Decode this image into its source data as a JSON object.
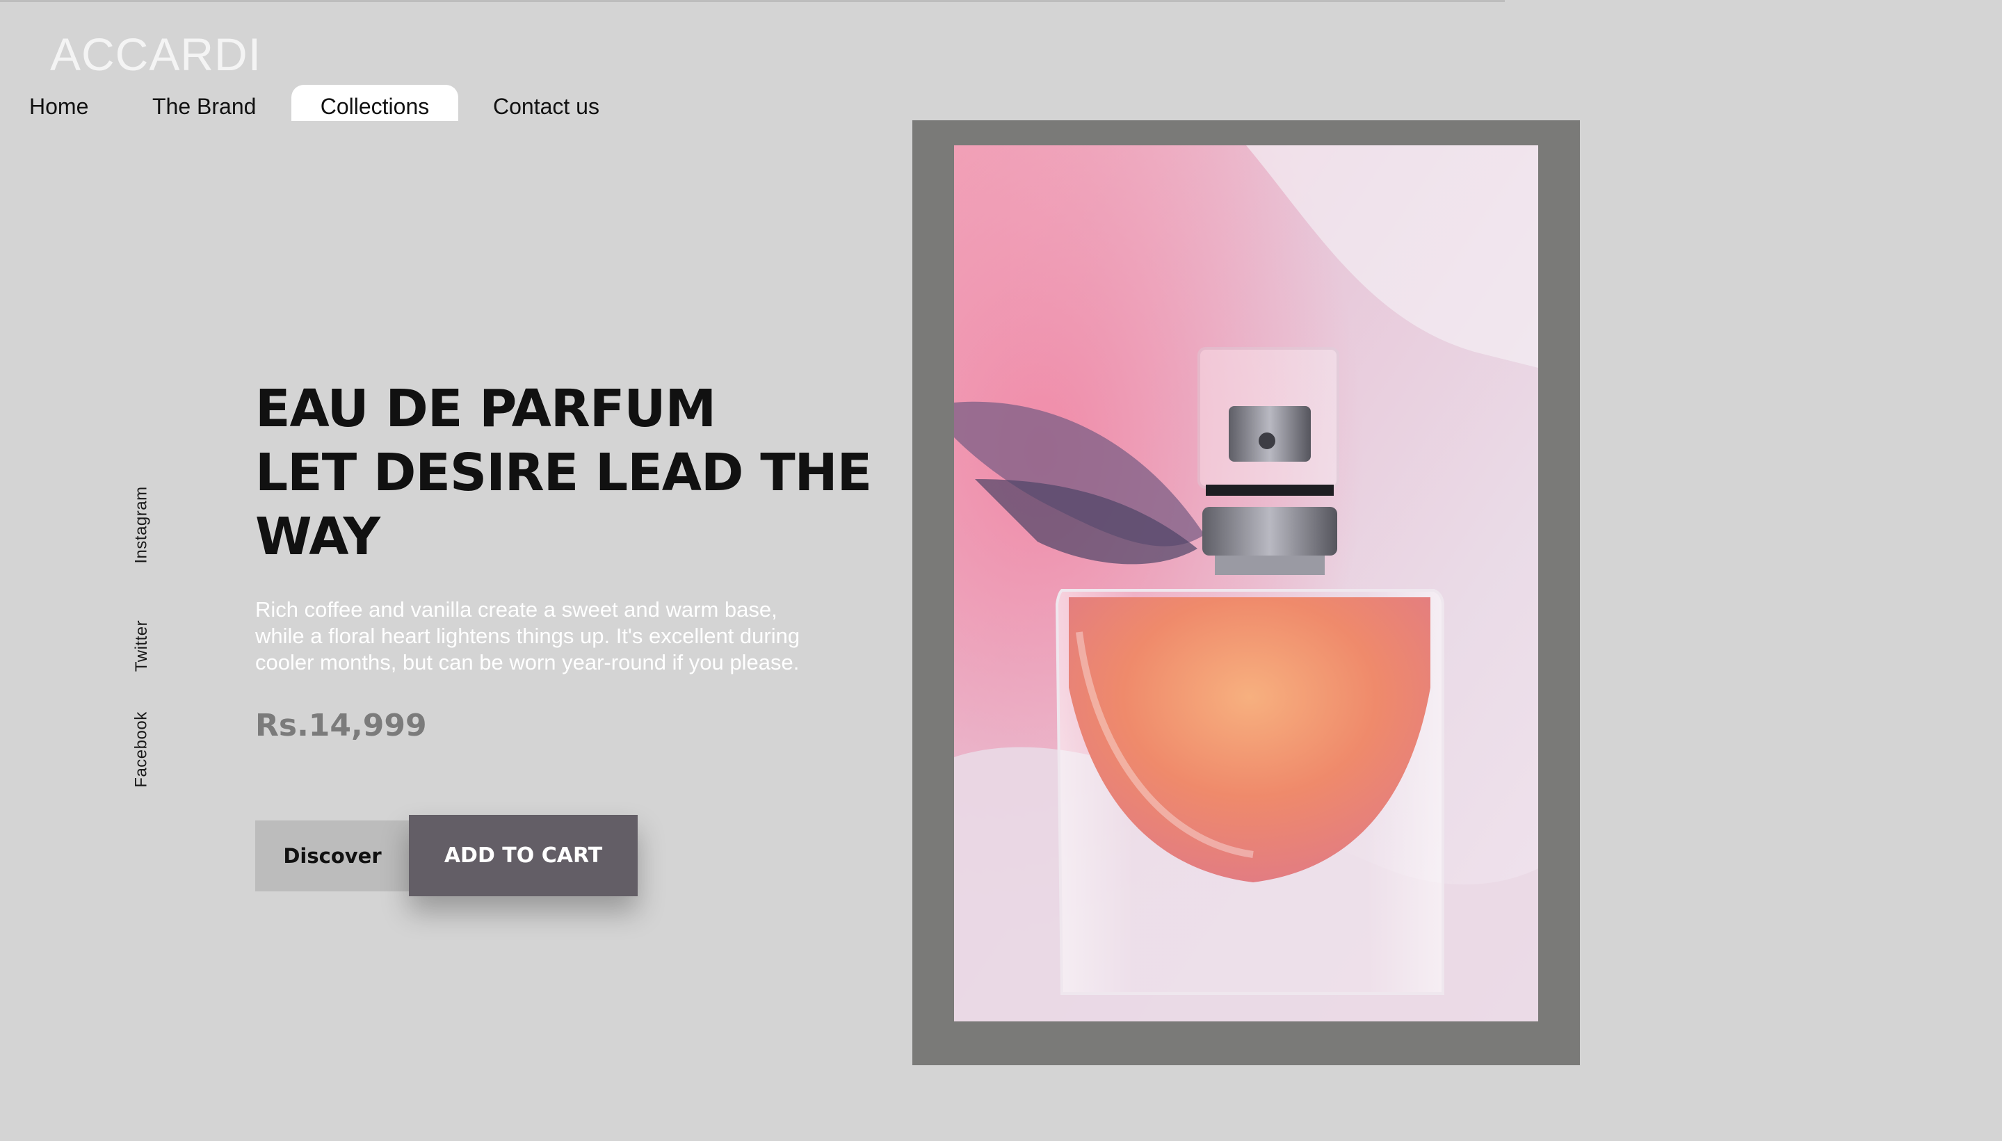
{
  "brand": {
    "logo_text": "ACCARDI"
  },
  "nav": {
    "items": [
      {
        "label": "Home"
      },
      {
        "label": "The Brand"
      },
      {
        "label": "Collections",
        "active": true
      },
      {
        "label": "Contact us"
      }
    ]
  },
  "social": {
    "instagram": "Instagram",
    "twitter": "Twitter",
    "facebook": "Facebook"
  },
  "hero": {
    "headline_lines": [
      "EAU DE PARFUM",
      "LET DESIRE LEAD THE",
      "WAY"
    ],
    "description_lines": [
      "Rich coffee and vanilla create a sweet and warm base,",
      "while a floral heart lightens things up. It's excellent during",
      "cooler months, but can be worn year-round if you please."
    ],
    "price": "Rs.14,999",
    "discover_label": "Discover",
    "cart_label": "ADD TO CART"
  },
  "colors": {
    "background": "#d4d4d4",
    "frame": "#7a7a78",
    "cart_button": "#635e66",
    "discover_button": "#bcbcbc",
    "price": "#7b7b7b"
  }
}
